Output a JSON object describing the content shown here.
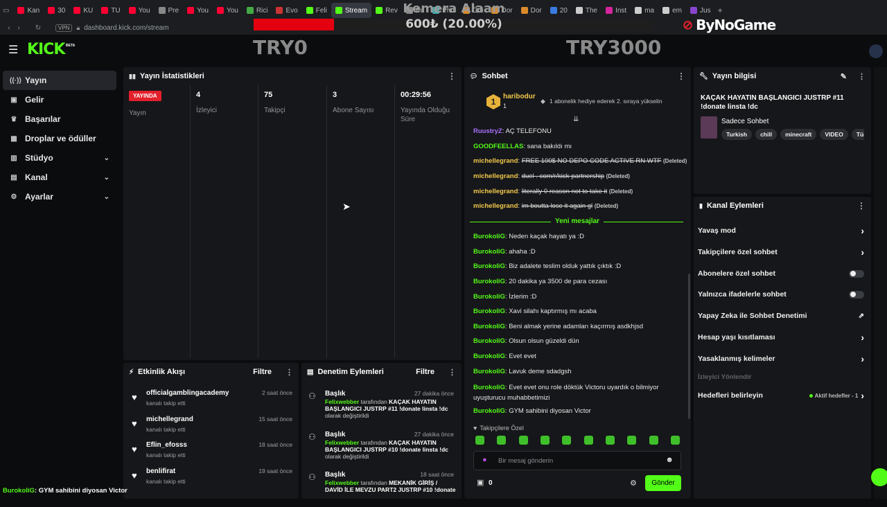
{
  "browser": {
    "tabs": [
      {
        "label": "Kan",
        "color": "#ff0033"
      },
      {
        "label": "30",
        "color": "#ff0033"
      },
      {
        "label": "KU",
        "color": "#ff0033"
      },
      {
        "label": "TU",
        "color": "#ff0033"
      },
      {
        "label": "You",
        "color": "#ff0033"
      },
      {
        "label": "Pre",
        "color": "#888888"
      },
      {
        "label": "You",
        "color": "#ff0033"
      },
      {
        "label": "You",
        "color": "#ff0033"
      },
      {
        "label": "Rici",
        "color": "#44aa44"
      },
      {
        "label": "Evo",
        "color": "#cc3333"
      },
      {
        "label": "Feli",
        "color": "#53fc18"
      },
      {
        "label": "Stream",
        "color": "#53fc18",
        "active": true
      },
      {
        "label": "Rev",
        "color": "#53fc18"
      },
      {
        "label": "Pu",
        "color": "#888888"
      },
      {
        "label": "Pho",
        "color": "#44aaaa"
      },
      {
        "label": "Ödi",
        "color": "#d98a2a"
      },
      {
        "label": "Dor",
        "color": "#d98a2a"
      },
      {
        "label": "Dor",
        "color": "#d98a2a"
      },
      {
        "label": "20",
        "color": "#3a7be0"
      },
      {
        "label": "The",
        "color": "#cccccc"
      },
      {
        "label": "Inst",
        "color": "#d6249f"
      },
      {
        "label": "ma",
        "color": "#cccccc"
      },
      {
        "label": "em",
        "color": "#cccccc"
      },
      {
        "label": "Jus",
        "color": "#8844cc"
      }
    ],
    "vpn_label": "VPN",
    "url": "dashboard.kick.com/stream"
  },
  "overlay": {
    "goal_title": "Kemera Alaam",
    "goal_progress_text": "600₺ (20.00%)",
    "goal_progress": 0.2,
    "goal_start": "TRY0",
    "goal_end": "TRY3000",
    "bynogame_logo": "ByNoGame"
  },
  "brand": {
    "logo": "KICK",
    "beta": "BETA",
    "accent": "#53fc18"
  },
  "sidebar": {
    "items": [
      {
        "label": "Yayın",
        "icon": "broadcast-icon"
      },
      {
        "label": "Gelir",
        "icon": "wallet-icon"
      },
      {
        "label": "Başarılar",
        "icon": "trophy-icon"
      },
      {
        "label": "Droplar ve ödüller",
        "icon": "gift-icon"
      },
      {
        "label": "Stüdyo",
        "icon": "studio-icon"
      },
      {
        "label": "Kanal",
        "icon": "channel-icon"
      },
      {
        "label": "Ayarlar",
        "icon": "gear-icon"
      }
    ]
  },
  "stats": {
    "title": "Yayın İstatistikleri",
    "live_badge": "YAYINDA",
    "live_label": "Yayın",
    "viewers": "4",
    "viewers_label": "İzleyici",
    "followers": "75",
    "followers_label": "Takipçi",
    "subs": "3",
    "subs_label": "Abone Sayısı",
    "uptime": "00:29:56",
    "uptime_label": "Yayında Olduğu Süre"
  },
  "activity": {
    "title": "Etkinlik Akışı",
    "filter": "Filtre",
    "items": [
      {
        "name": "officialgamblingacademy",
        "sub": "kanalı takip etti",
        "time": "2 saat önce"
      },
      {
        "name": "michellegrand",
        "sub": "kanalı takip etti",
        "time": "15 saat önce"
      },
      {
        "name": "Eflin_efosss",
        "sub": "kanalı takip etti",
        "time": "18 saat önce"
      },
      {
        "name": "benlifirat",
        "sub": "kanalı takip etti",
        "time": "19 saat önce"
      }
    ]
  },
  "moderation": {
    "title": "Denetim Eylemleri",
    "filter": "Filtre",
    "items": [
      {
        "title": "Başlık",
        "time": "27 dakika önce",
        "user": "Felixwebber",
        "by": "tarafından",
        "text": "KAÇAK HAYATIN BAŞLANGICI JUSTRP #11 !donate linsta !dc",
        "suffix": "olarak değiştirildi"
      },
      {
        "title": "Başlık",
        "time": "27 dakika önce",
        "user": "Felixwebber",
        "by": "tarafından",
        "text": "KAÇAK HAYATIN BAŞLANGICI JUSTRP #10 !donate linsta !dc",
        "suffix": "olarak değiştirildi"
      },
      {
        "title": "Başlık",
        "time": "18 saat önce",
        "user": "Felixwebber",
        "by": "tarafından",
        "text": "MEKANİK GİRİŞ / DAVİD İLE MEVZU PART2 JUSTRP #10 !donate",
        "suffix": ""
      }
    ]
  },
  "chat": {
    "title": "Sohbet",
    "pinned_user": "haribodur",
    "pinned_rank": "1",
    "pinned_msg": "1 abonelik hediye ederek 2. sıraya yükselin",
    "new_messages": "Yeni mesajlar",
    "messages": [
      {
        "user": "RuustryZ",
        "color": "#a970ff",
        "text": "AÇ TELEFONU"
      },
      {
        "user": "GOODFEELLAS",
        "color": "#53fc18",
        "text": "sana bakıldı mı"
      },
      {
        "user": "michellegrand",
        "color": "#f2c94c",
        "text": "FREE 100$ NO DEPO CODE ACTIVE RN WTF",
        "deleted": "(Deleted)"
      },
      {
        "user": "michellegrand",
        "color": "#f2c94c",
        "text": "duel . com/r/kick-partnership",
        "deleted": "(Deleted)"
      },
      {
        "user": "michellegrand",
        "color": "#f2c94c",
        "text": "literally 0 reason not to take it",
        "deleted": "(Deleted)"
      },
      {
        "user": "michellegrand",
        "color": "#f2c94c",
        "text": "im boutta lose it again gl",
        "deleted": "(Deleted)"
      },
      {
        "user": "BurokoliG",
        "color": "#53fc18",
        "text": "Neden kaçak hayatı ya :D"
      },
      {
        "user": "BurokoliG",
        "color": "#53fc18",
        "text": "ahaha :D"
      },
      {
        "user": "BurokoliG",
        "color": "#53fc18",
        "text": "Biz adalete teslim olduk yattık çıktık :D"
      },
      {
        "user": "BurokoliG",
        "color": "#53fc18",
        "text": "20 dakika ya 3500 de para cezası"
      },
      {
        "user": "BurokoliG",
        "color": "#53fc18",
        "text": "İzlerim :D"
      },
      {
        "user": "BurokoliG",
        "color": "#53fc18",
        "text": "Xavi silahı kaptırmış mı acaba"
      },
      {
        "user": "BurokoliG",
        "color": "#53fc18",
        "text": "Beni almak yerine adamları kaçırmış asdkhjsd"
      },
      {
        "user": "BurokoliG",
        "color": "#53fc18",
        "text": "Olsun olsun güzeldi dün"
      },
      {
        "user": "BurokoliG",
        "color": "#53fc18",
        "text": "Evet evet"
      },
      {
        "user": "BurokoliG",
        "color": "#53fc18",
        "text": "Lavuk deme sdadgsh"
      },
      {
        "user": "BurokoliG",
        "color": "#53fc18",
        "text": "Evet evet onu role döktük Victoru uyardık o bilmiyor",
        "text2": "uyuşturucu muhabbetimizi"
      },
      {
        "user": "BurokoliG",
        "color": "#53fc18",
        "text": "GYM sahibini diyosan Victor"
      }
    ],
    "followers_only": "Takipçilere Özel",
    "input_placeholder": "Bir mesaj gönderin",
    "points": "0",
    "send": "Gönder"
  },
  "stream_info": {
    "title": "Yayın bilgisi",
    "stream_title": "KAÇAK HAYATIN BAŞLANGICI JUSTRP #11 !donate linsta !dc",
    "category": "Sadece Sohbet",
    "tags": [
      "Turkish",
      "chill",
      "minecraft",
      "VIDEO",
      "Türkç"
    ]
  },
  "channel_actions": {
    "title": "Kanal Eylemleri",
    "items": [
      {
        "label": "Yavaş mod",
        "kind": "arrow"
      },
      {
        "label": "Takipçilere özel sohbet",
        "kind": "arrow"
      },
      {
        "label": "Abonelere özel sohbet",
        "kind": "toggle"
      },
      {
        "label": "Yalnızca ifadelerle sohbet",
        "kind": "toggle"
      },
      {
        "label": "Yapay Zeka ile Sohbet Denetimi",
        "kind": "external"
      },
      {
        "label": "Hesap yaşı kısıtlaması",
        "kind": "arrow"
      },
      {
        "label": "Yasaklanmış kelimeler",
        "kind": "arrow"
      }
    ],
    "redirect_label": "İzleyici Yönlendir",
    "targets_label": "Hedefleri belirleyin",
    "targets_status": "Aktif hedefler - 1"
  },
  "ticker": {
    "user": "BurokoliG",
    "text": ": GYM sahibini diyosan Victor"
  }
}
